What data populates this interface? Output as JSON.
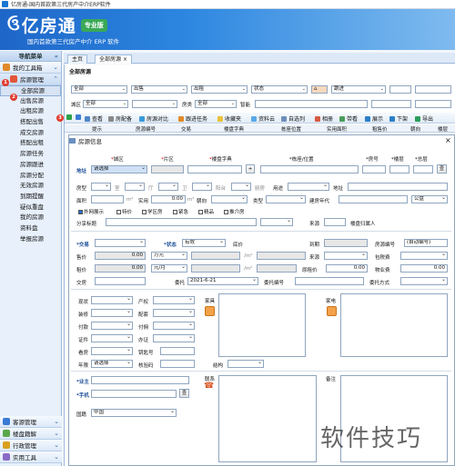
{
  "window": {
    "title": "亿房通-国内首款第三代房产中介ERP软件"
  },
  "banner": {
    "logo_symbol": "ઉ",
    "app_name": "亿房通",
    "edition_badge": "专业版",
    "slogan": "国内首款第三代房产中介 ERP 软件"
  },
  "sidebar": {
    "header": "导航菜单",
    "groups_top": [
      {
        "label": "我的工具箱"
      },
      {
        "label": "房源管理"
      }
    ],
    "items": [
      "全部房源",
      "出售房源",
      "出租房源",
      "搭配出售",
      "成交房源",
      "搭配出租",
      "房源任务",
      "房源跟进",
      "房源分配",
      "无效房源",
      "到期提醒",
      "疑似重盘",
      "我的房源",
      "资料盘",
      "举报房源"
    ],
    "groups_bottom": [
      {
        "label": "客源管理"
      },
      {
        "label": "楼盘籍解"
      },
      {
        "label": "行政管理"
      },
      {
        "label": "实用工具"
      }
    ],
    "markers": [
      "1",
      "2",
      "3"
    ]
  },
  "tabs": [
    "主页",
    "全部房源"
  ],
  "content": {
    "section_title": "全部房源",
    "filters_row1": [
      "全部",
      "出售",
      "出租",
      "状态",
      "跟进"
    ],
    "filters_row2": [
      "城区",
      "全部",
      "房类",
      "全部",
      "智能"
    ],
    "toolbar": [
      "查看",
      "房配备",
      "房源对比",
      "跟进任务",
      "收藏夹",
      "资料云",
      "自选列",
      "相册",
      "带看",
      "展示",
      "下架",
      "导出"
    ],
    "grid_headers": [
      "提示",
      "房源编号",
      "交易",
      "楼盘字典",
      "栋座位置",
      "实用面积",
      "租售价",
      "朝向",
      "楼层"
    ]
  },
  "dialog": {
    "title": "房源信息",
    "close": "×",
    "row_location": {
      "城区": "城区",
      "片区": "片区",
      "楼盘字典": "楼盘字典",
      "栋座位置": "*栋座/位置",
      "房号": "*房号",
      "楼层": "*楼层",
      "总层": "*总层",
      "address_label": "地址",
      "district_value": "请选择",
      "add_btn": "+",
      "search_btn": "查"
    },
    "row_house": {
      "房型": "房型",
      "室": "室",
      "厅": "厅",
      "卫": "卫",
      "阳台": "阳台",
      "厨房": "厨房",
      "用途": "用途",
      "地址2": "地址"
    },
    "row_area": {
      "面积": "面积",
      "m2": "m²",
      "实用": "实用",
      "实用值": "0.00",
      "朝向": "朝向",
      "类型": "类型",
      "建房年代": "建房年代",
      "年": "公盘"
    },
    "checks": [
      "外网展示",
      "特价",
      "学区房",
      "紧急",
      "精品",
      "推介房"
    ],
    "row_share": {
      "分享标题": "分享标题",
      "来源": "来源",
      "楼盘归属人": "楼盘归属人"
    },
    "trade": {
      "交易": "*交易",
      "状态": "*状态",
      "状态值": "有效",
      "底价": "底价",
      "到期": "到期",
      "房源编号": "房源编号",
      "编号值": "(自动编号)",
      "售价": "售价",
      "售价值": "0.00",
      "单位1": "万元",
      "m2_1": "/m²",
      "来源": "来源",
      "包税费": "包税费",
      "租价": "租价",
      "租价值": "0.00",
      "单位2": "元/月",
      "m2_2": "/m²",
      "原租价": "原租价",
      "原租价值": "0.00",
      "物业费": "物业费",
      "物业费值": "0.00",
      "交房": "交房",
      "委托": "委托",
      "委托日期": "2021-6-21",
      "委托编号": "委托编号",
      "委托方式": "委托方式"
    },
    "features": {
      "现状": "现状",
      "产权": "产权",
      "装修": "装修",
      "配套": "配套",
      "付款": "付款",
      "付佣": "付佣",
      "证件": "证件",
      "办证": "办证",
      "看房": "看房",
      "钥匙号": "钥匙号",
      "年限": "年限",
      "年限值": "请选择",
      "核验码": "核验码",
      "结构": "结构",
      "家具": "家具",
      "家电": "家电"
    },
    "owner": {
      "业主": "*业主",
      "手机": "*手机",
      "查": "查",
      "联系": "联系",
      "备注": "备注",
      "国籍": "国籍",
      "国籍值": "中国"
    }
  },
  "watermark": "软件技巧"
}
